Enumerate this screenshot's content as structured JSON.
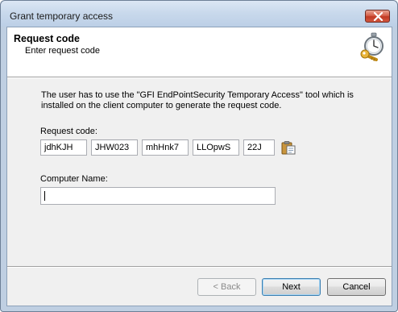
{
  "window": {
    "title": "Grant temporary access",
    "close_icon": "close-icon"
  },
  "header": {
    "title": "Request code",
    "subtitle": "Enter request code",
    "icon": "stopwatch-key-icon"
  },
  "description": "The user has to use the \"GFI EndPointSecurity Temporary Access\" tool which is installed on the client computer to generate the request code.",
  "request_code": {
    "label": "Request code:",
    "parts": [
      "jdhKJH",
      "JHW023",
      "mhHnk7",
      "LLOpwS",
      "22J"
    ],
    "paste_icon": "paste-clipboard-icon"
  },
  "computer_name": {
    "label": "Computer Name:",
    "value": ""
  },
  "buttons": {
    "back": "< Back",
    "next": "Next",
    "cancel": "Cancel"
  },
  "colors": {
    "titlebar": "#c9d9ec",
    "dialog_bg": "#f0f0f0",
    "close_button": "#c13a23"
  }
}
